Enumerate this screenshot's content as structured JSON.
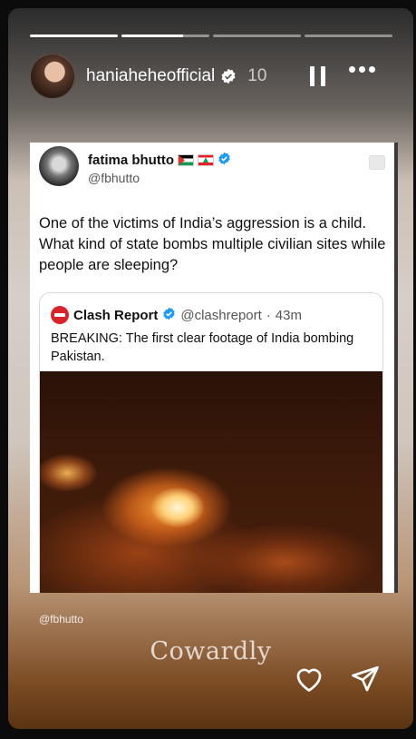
{
  "story": {
    "username": "haniaheheofficial",
    "time": "10",
    "progress_segments": [
      {
        "state": "done"
      },
      {
        "state": "active",
        "progress": 0.7
      },
      {
        "state": "pending"
      },
      {
        "state": "pending"
      }
    ]
  },
  "post": {
    "author_name": "fatima bhutto",
    "author_handle": "@fbhutto",
    "flags": [
      "palestine-flag-icon",
      "lebanon-flag-icon"
    ],
    "text": "One of the victims of India’s aggression is a child. What kind of state bombs multiple civilian sites while people are sleeping?",
    "quote": {
      "name": "Clash Report",
      "handle": "@clashreport",
      "separator": "·",
      "time": "43m",
      "text": "BREAKING: The first clear footage of India bombing Pakistan."
    }
  },
  "credit": "@fbhutto",
  "caption": "Cowardly",
  "colors": {
    "verified_blue": "#1d9bf0",
    "clash_red": "#d9242b"
  }
}
